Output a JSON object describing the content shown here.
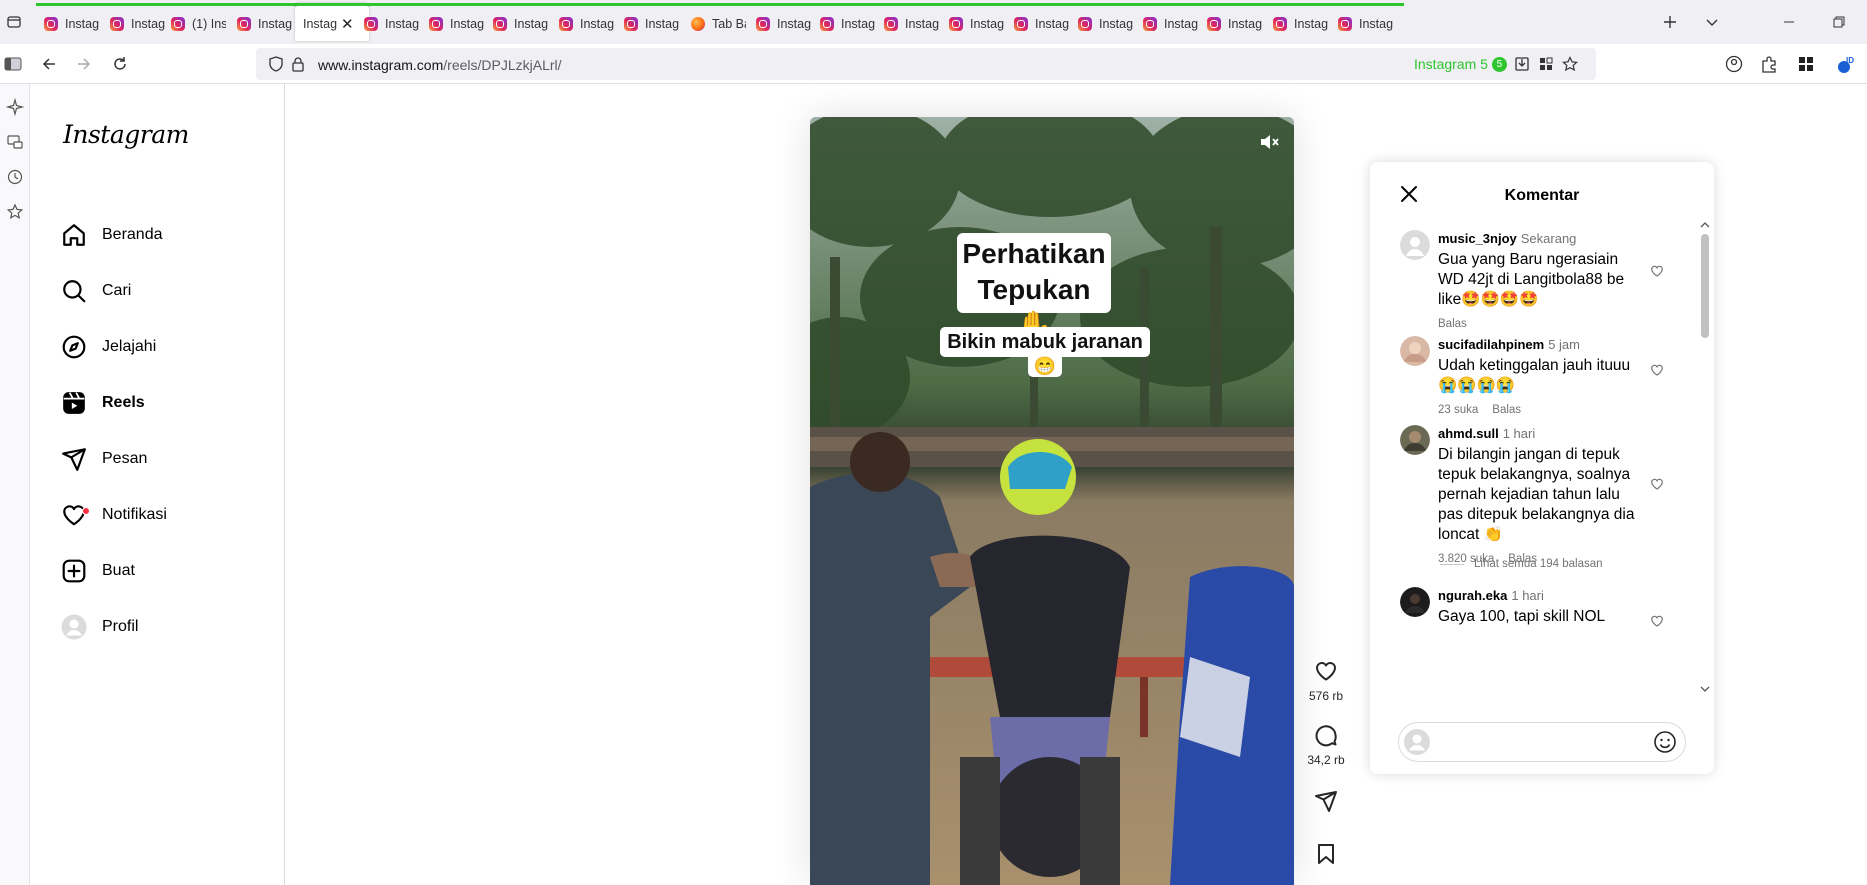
{
  "browser": {
    "tabs": [
      {
        "title": "Instagram",
        "icon": "instagram-favicon"
      },
      {
        "title": "Instagram",
        "icon": "instagram-favicon"
      },
      {
        "title": "(1) Instagram",
        "icon": "instagram-favicon"
      },
      {
        "title": "Instagram",
        "icon": "instagram-favicon"
      },
      {
        "title": "Instagram",
        "icon": "none",
        "active": true
      },
      {
        "title": "Instagram",
        "icon": "instagram-favicon"
      },
      {
        "title": "Instagram",
        "icon": "instagram-favicon"
      },
      {
        "title": "Instagram",
        "icon": "instagram-favicon"
      },
      {
        "title": "Instagram",
        "icon": "instagram-favicon"
      },
      {
        "title": "Instagram",
        "icon": "instagram-favicon"
      },
      {
        "title": "Tab Baru",
        "icon": "firefox-favicon"
      },
      {
        "title": "Instagram",
        "icon": "instagram-favicon"
      },
      {
        "title": "Instagram",
        "icon": "instagram-favicon"
      },
      {
        "title": "Instagram",
        "icon": "instagram-favicon"
      },
      {
        "title": "Instagram",
        "icon": "instagram-favicon"
      },
      {
        "title": "Instagram",
        "icon": "instagram-favicon"
      },
      {
        "title": "Instagram",
        "icon": "instagram-favicon"
      },
      {
        "title": "Instagram",
        "icon": "instagram-favicon"
      },
      {
        "title": "Instagram",
        "icon": "instagram-favicon"
      },
      {
        "title": "Instagram",
        "icon": "instagram-favicon"
      },
      {
        "title": "Instagram",
        "icon": "instagram-favicon"
      }
    ],
    "url_host": "www.instagram.com",
    "url_path": "/reels/DPJLzkjALrl/",
    "container_label": "Instagram 5",
    "container_count": "5",
    "accent_color": "#2ec52e"
  },
  "ig_nav": {
    "logo": "Instagram",
    "items": [
      {
        "label": "Beranda",
        "icon": "home-icon"
      },
      {
        "label": "Cari",
        "icon": "search-icon"
      },
      {
        "label": "Jelajahi",
        "icon": "compass-icon"
      },
      {
        "label": "Reels",
        "icon": "reels-icon",
        "active": true
      },
      {
        "label": "Pesan",
        "icon": "send-icon"
      },
      {
        "label": "Notifikasi",
        "icon": "heart-icon",
        "badge": true
      },
      {
        "label": "Buat",
        "icon": "plus-square-icon"
      },
      {
        "label": "Profil",
        "icon": "avatar"
      }
    ]
  },
  "reel": {
    "caption_title_line1": "Perhatikan",
    "caption_title_line2": "Tepukan ✋",
    "caption_sub": "Bikin mabuk jaranan",
    "caption_emoji": "😁",
    "likes": "576 rb",
    "comments": "34,2 rb"
  },
  "comments_panel": {
    "title": "Komentar",
    "items": [
      {
        "user": "music_3njoy",
        "time": "Sekarang",
        "text": "Gua yang Baru ngerasiain WD 42jt di Langitbola88 be like🤩🤩🤩🤩",
        "likes": "",
        "reply": "Balas"
      },
      {
        "user": "sucifadilahpinem",
        "time": "5 jam",
        "text": "Udah ketinggalan jauh ituuu😭😭😭😭",
        "likes": "23 suka",
        "reply": "Balas"
      },
      {
        "user": "ahmd.sull",
        "time": "1 hari",
        "text": "Di bilangin jangan di tepuk tepuk belakangnya, soalnya pernah kejadian tahun lalu pas ditepuk belakangnya dia loncat 👏",
        "likes": "3.820 suka",
        "reply": "Balas",
        "view_replies": "Lihat semua 194 balasan"
      },
      {
        "user": "ngurah.eka",
        "time": "1 hari",
        "text": "Gaya 100, tapi skill NOL",
        "likes": "",
        "reply": ""
      }
    ],
    "input_placeholder": ""
  }
}
